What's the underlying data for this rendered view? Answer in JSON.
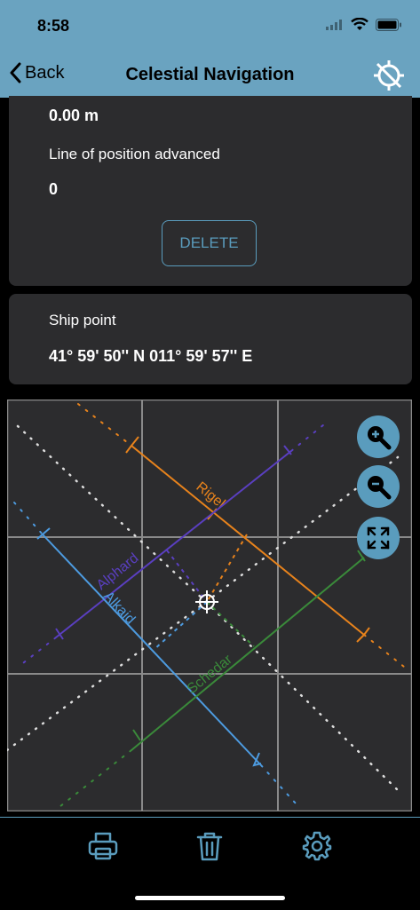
{
  "status": {
    "time": "8:58"
  },
  "nav": {
    "back_label": "Back",
    "title": "Celestial Navigation"
  },
  "card1": {
    "distance_value": "0.00 m",
    "lop_label": "Line of position advanced",
    "lop_value": "0",
    "delete_label": "DELETE"
  },
  "ship": {
    "label": "Ship point",
    "value": "41° 59' 50'' N 011° 59' 57'' E"
  },
  "plot": {
    "lines": [
      {
        "name": "Rigel",
        "color": "#e8831c"
      },
      {
        "name": "Alphard",
        "color": "#5a3fc0"
      },
      {
        "name": "Alkaid",
        "color": "#4d9be0"
      },
      {
        "name": "Schedar",
        "color": "#3a8a3a"
      }
    ],
    "controls": {
      "zoom_in": "zoom-in-icon",
      "zoom_out": "zoom-out-icon",
      "fit": "fit-icon"
    }
  },
  "toolbar": {
    "items": [
      "printer-icon",
      "trash-icon",
      "gear-icon"
    ]
  },
  "colors": {
    "accent": "#5a9cbd",
    "header": "#6aa3c0",
    "card": "#2c2c2e"
  }
}
